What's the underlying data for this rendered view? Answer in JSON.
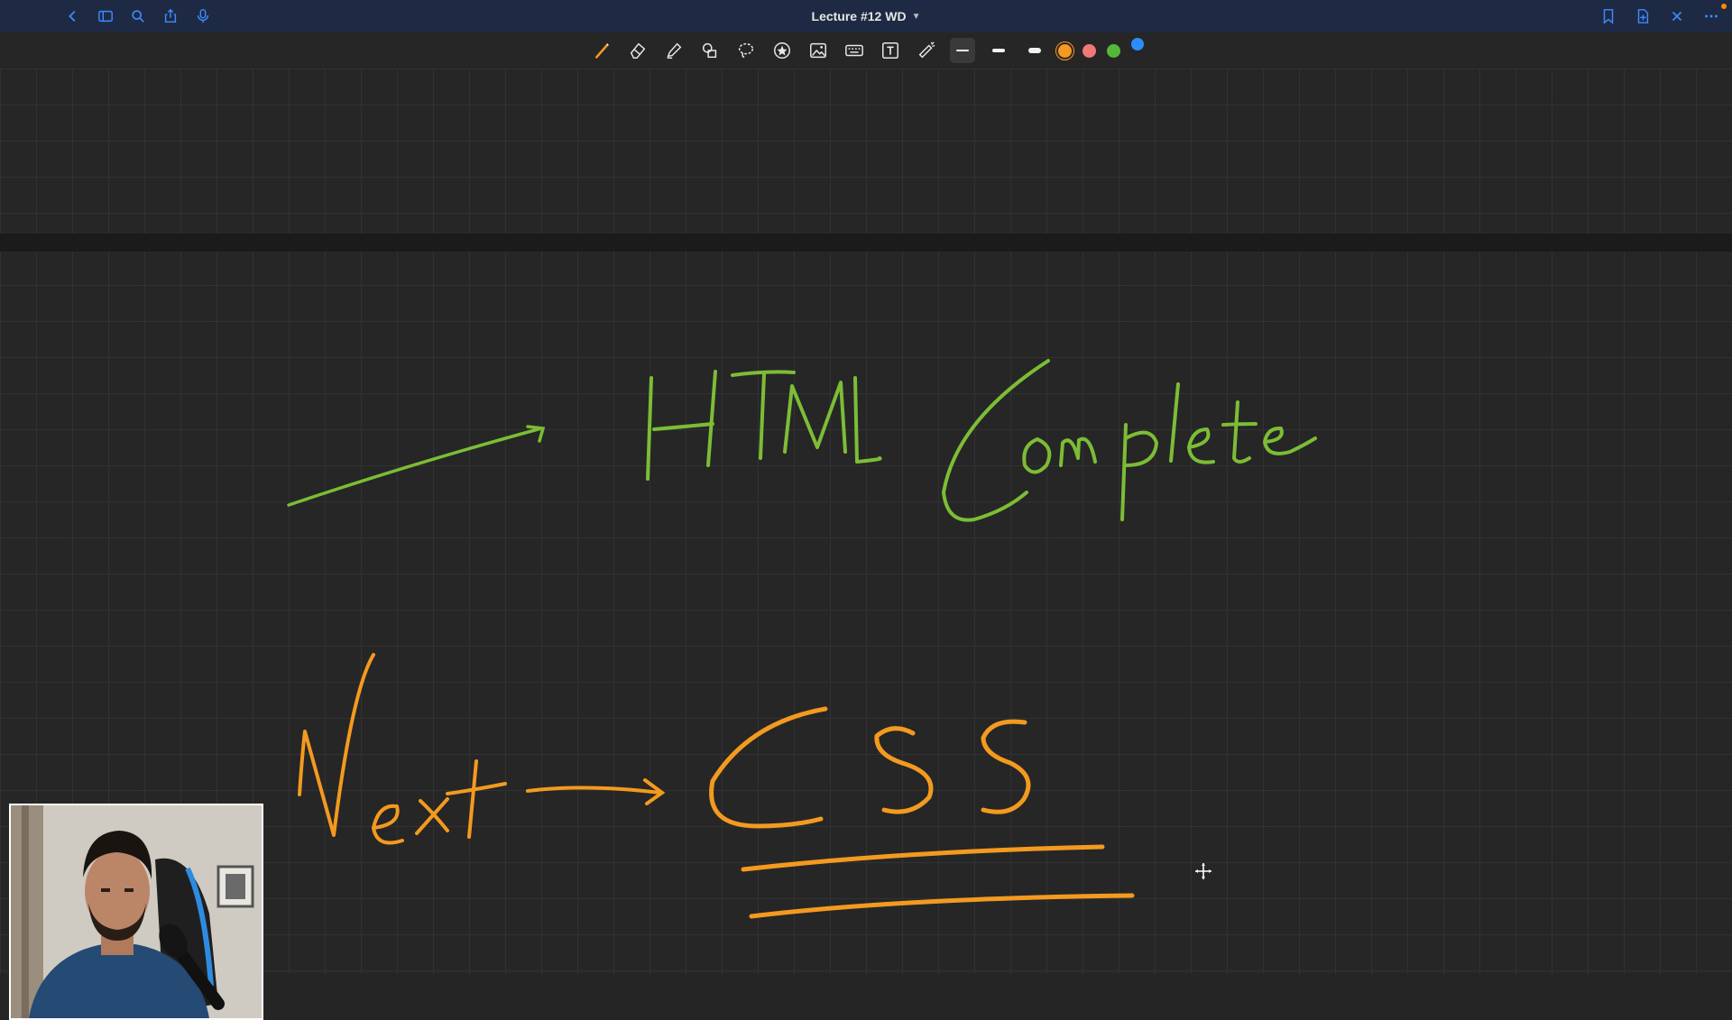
{
  "window": {
    "title": "Lecture #12 WD",
    "left_icons": [
      "back-icon",
      "sidebar-icon",
      "search-icon",
      "share-icon",
      "microphone-icon"
    ],
    "right_icons": [
      "bookmark-icon",
      "add-page-icon",
      "close-icon",
      "more-icon"
    ]
  },
  "toolbar": {
    "tools": [
      "pen-tool",
      "eraser-tool",
      "highlighter-tool",
      "shapes-tool",
      "lasso-tool",
      "sticker-tool",
      "image-tool",
      "keyboard-tool",
      "text-tool",
      "laser-pointer-tool"
    ],
    "stroke_widths": [
      "thin",
      "medium",
      "thick"
    ],
    "selected_stroke": "thin",
    "colors": [
      "#f39a1f",
      "#f27878",
      "#55b83a"
    ],
    "selected_color": "#f39a1f"
  },
  "canvas": {
    "background": "#262626",
    "grid_color": "#323232",
    "handwriting": {
      "line1_color": "#7cbd35",
      "line1_text": "→ HTML Complete",
      "line2_color": "#f39a1f",
      "line2_text": "Next → CSS"
    }
  }
}
